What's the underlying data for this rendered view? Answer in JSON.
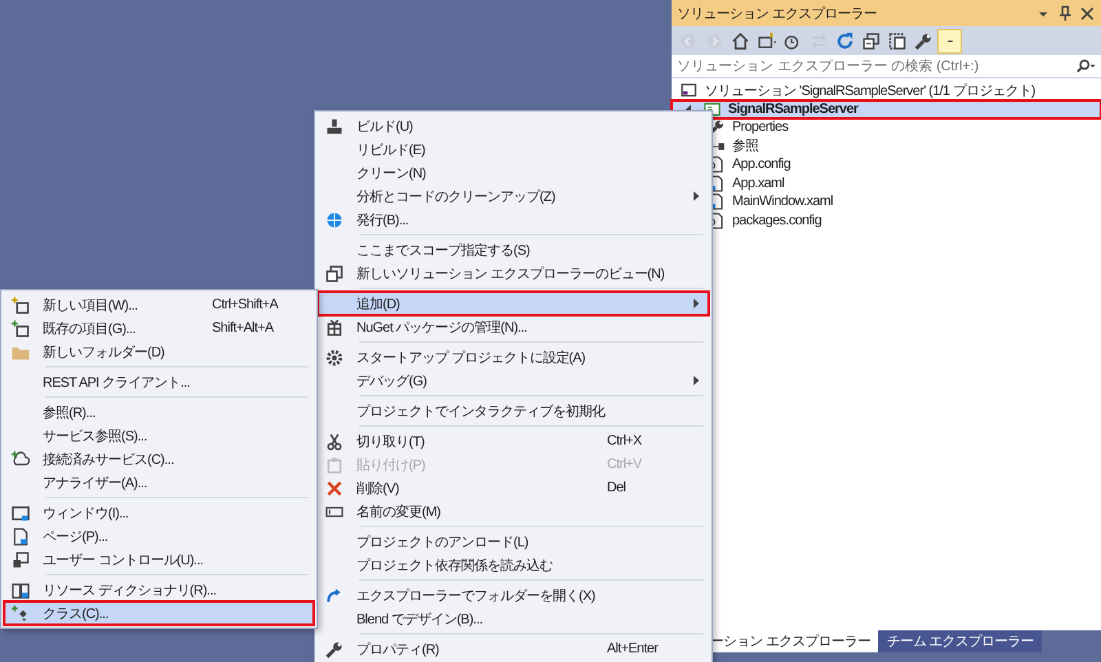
{
  "explorer": {
    "title": "ソリューション エクスプローラー",
    "search": {
      "placeholder": "ソリューション エクスプローラー の検索 (Ctrl+:)"
    },
    "toolbar": [
      {
        "disabled": true,
        "selected": false
      },
      {
        "disabled": true,
        "selected": false
      },
      {
        "disabled": false,
        "selected": false
      },
      {
        "disabled": false,
        "selected": false
      },
      {
        "disabled": false,
        "selected": false
      },
      {
        "disabled": true,
        "selected": false
      },
      {
        "disabled": false,
        "selected": false
      },
      {
        "disabled": false,
        "selected": false
      },
      {
        "disabled": false,
        "selected": false
      },
      {
        "disabled": false,
        "selected": false
      },
      {
        "disabled": false,
        "selected": true
      }
    ],
    "tree": [
      {
        "label": "ソリューション 'SignalRSampleServer' (1/1 プロジェクト)",
        "selected": false,
        "annotated": false,
        "children": [
          {
            "label": "SignalRSampleServer",
            "expanded": true,
            "selected": true,
            "annotated": true,
            "children": [
              {
                "label": "Properties",
                "selected": false,
                "annotated": false
              },
              {
                "label": "参照",
                "selected": false,
                "annotated": false
              },
              {
                "label": "App.config",
                "selected": false,
                "annotated": false
              },
              {
                "label": "App.xaml",
                "selected": false,
                "annotated": false
              },
              {
                "label": "MainWindow.xaml",
                "selected": false,
                "annotated": false
              },
              {
                "label": "packages.config",
                "selected": false,
                "annotated": false
              }
            ]
          }
        ]
      }
    ],
    "tabs": [
      {
        "label": "ーション エクスプローラー",
        "selected": true
      },
      {
        "label": "チーム エクスプローラー",
        "selected": false
      }
    ]
  },
  "context_menu": [
    {
      "kind": "item",
      "label": "ビルド(U)",
      "selected": false,
      "disabled": false,
      "annotated": false
    },
    {
      "kind": "item",
      "label": "リビルド(E)",
      "selected": false,
      "disabled": false,
      "annotated": false
    },
    {
      "kind": "item",
      "label": "クリーン(N)",
      "selected": false,
      "disabled": false,
      "annotated": false
    },
    {
      "kind": "submenu",
      "label": "分析とコードのクリーンアップ(Z)",
      "selected": false,
      "disabled": false,
      "annotated": false
    },
    {
      "kind": "item",
      "label": "発行(B)...",
      "selected": false,
      "disabled": false,
      "annotated": false
    },
    {
      "kind": "separator"
    },
    {
      "kind": "item",
      "label": "ここまでスコープ指定する(S)",
      "selected": false,
      "disabled": false,
      "annotated": false
    },
    {
      "kind": "item",
      "label": "新しいソリューション エクスプローラーのビュー(N)",
      "selected": false,
      "disabled": false,
      "annotated": false
    },
    {
      "kind": "separator"
    },
    {
      "kind": "submenu",
      "label": "追加(D)",
      "selected": true,
      "disabled": false,
      "annotated": true
    },
    {
      "kind": "item",
      "label": "NuGet パッケージの管理(N)...",
      "selected": false,
      "disabled": false,
      "annotated": false
    },
    {
      "kind": "separator"
    },
    {
      "kind": "item",
      "label": "スタートアップ プロジェクトに設定(A)",
      "selected": false,
      "disabled": false,
      "annotated": false
    },
    {
      "kind": "submenu",
      "label": "デバッグ(G)",
      "selected": false,
      "disabled": false,
      "annotated": false
    },
    {
      "kind": "separator"
    },
    {
      "kind": "item",
      "label": "プロジェクトでインタラクティブを初期化",
      "selected": false,
      "disabled": false,
      "annotated": false
    },
    {
      "kind": "separator"
    },
    {
      "kind": "item",
      "label": "切り取り(T)",
      "shortcut": "Ctrl+X",
      "selected": false,
      "disabled": false,
      "annotated": false
    },
    {
      "kind": "item",
      "label": "貼り付け(P)",
      "shortcut": "Ctrl+V",
      "selected": false,
      "disabled": true,
      "annotated": false
    },
    {
      "kind": "item",
      "label": "削除(V)",
      "shortcut": "Del",
      "selected": false,
      "disabled": false,
      "annotated": false
    },
    {
      "kind": "item",
      "label": "名前の変更(M)",
      "selected": false,
      "disabled": false,
      "annotated": false
    },
    {
      "kind": "separator"
    },
    {
      "kind": "item",
      "label": "プロジェクトのアンロード(L)",
      "selected": false,
      "disabled": false,
      "annotated": false
    },
    {
      "kind": "item",
      "label": "プロジェクト依存関係を読み込む",
      "selected": false,
      "disabled": false,
      "annotated": false
    },
    {
      "kind": "separator"
    },
    {
      "kind": "item",
      "label": "エクスプローラーでフォルダーを開く(X)",
      "selected": false,
      "disabled": false,
      "annotated": false
    },
    {
      "kind": "item",
      "label": "Blend でデザイン(B)...",
      "selected": false,
      "disabled": false,
      "annotated": false
    },
    {
      "kind": "separator"
    },
    {
      "kind": "item",
      "label": "プロパティ(R)",
      "shortcut": "Alt+Enter",
      "selected": false,
      "disabled": false,
      "annotated": false
    }
  ],
  "add_submenu": [
    {
      "kind": "item",
      "label": "新しい項目(W)...",
      "shortcut": "Ctrl+Shift+A",
      "selected": false,
      "disabled": false,
      "annotated": false
    },
    {
      "kind": "item",
      "label": "既存の項目(G)...",
      "shortcut": "Shift+Alt+A",
      "selected": false,
      "disabled": false,
      "annotated": false
    },
    {
      "kind": "item",
      "label": "新しいフォルダー(D)",
      "selected": false,
      "disabled": false,
      "annotated": false
    },
    {
      "kind": "separator"
    },
    {
      "kind": "item",
      "label": "REST API クライアント...",
      "selected": false,
      "disabled": false,
      "annotated": false
    },
    {
      "kind": "separator"
    },
    {
      "kind": "item",
      "label": "参照(R)...",
      "selected": false,
      "disabled": false,
      "annotated": false
    },
    {
      "kind": "item",
      "label": "サービス参照(S)...",
      "selected": false,
      "disabled": false,
      "annotated": false
    },
    {
      "kind": "item",
      "label": "接続済みサービス(C)...",
      "selected": false,
      "disabled": false,
      "annotated": false
    },
    {
      "kind": "item",
      "label": "アナライザー(A)...",
      "selected": false,
      "disabled": false,
      "annotated": false
    },
    {
      "kind": "separator"
    },
    {
      "kind": "item",
      "label": "ウィンドウ(I)...",
      "selected": false,
      "disabled": false,
      "annotated": false
    },
    {
      "kind": "item",
      "label": "ページ(P)...",
      "selected": false,
      "disabled": false,
      "annotated": false
    },
    {
      "kind": "item",
      "label": "ユーザー コントロール(U)...",
      "selected": false,
      "disabled": false,
      "annotated": false
    },
    {
      "kind": "separator"
    },
    {
      "kind": "item",
      "label": "リソース ディクショナリ(R)...",
      "selected": false,
      "disabled": false,
      "annotated": false
    },
    {
      "kind": "item",
      "label": "クラス(C)...",
      "selected": true,
      "disabled": false,
      "annotated": true
    }
  ]
}
